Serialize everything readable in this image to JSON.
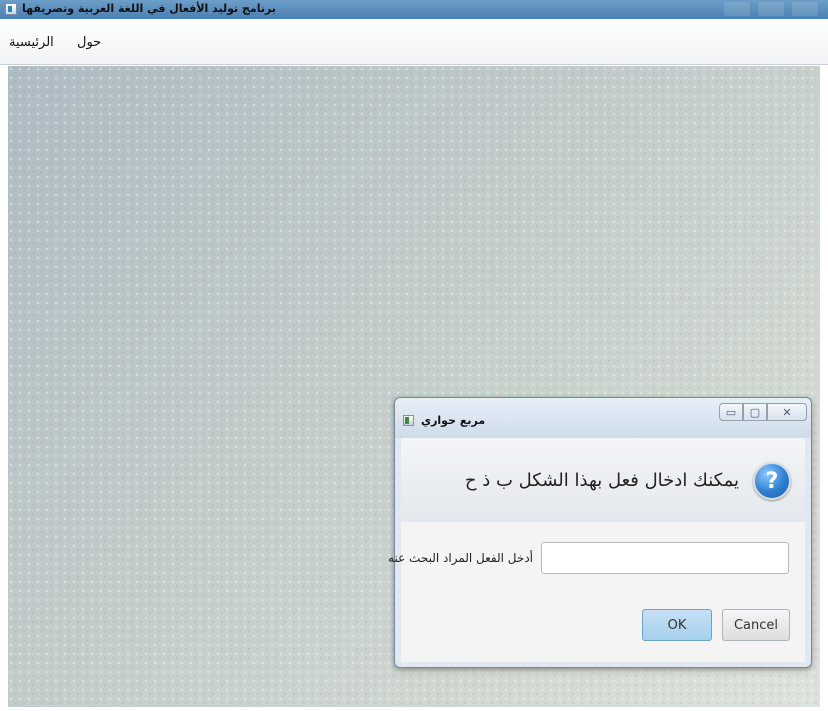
{
  "window": {
    "title": "برنامج  توليد الأفعال في اللغة العربية وتصريفها"
  },
  "menubar": {
    "items": [
      {
        "label": "الرئيسية"
      },
      {
        "label": "حول"
      }
    ]
  },
  "dialog": {
    "title": "مربع حواري",
    "message": "يمكنك ادخال فعل بهذا الشكل   ب ذ ح",
    "field_label": "أدخل الفعل المراد البحث عنه",
    "field_value": "",
    "ok_label": "OK",
    "cancel_label": "Cancel",
    "icon": "question-icon",
    "window_controls": {
      "minimize": "▭",
      "maximize": "▢",
      "close": "✕"
    }
  },
  "colors": {
    "titlebar": "#4b7fb0",
    "ok_button": "#a7d0ec",
    "question_icon": "#2f7fd0"
  }
}
